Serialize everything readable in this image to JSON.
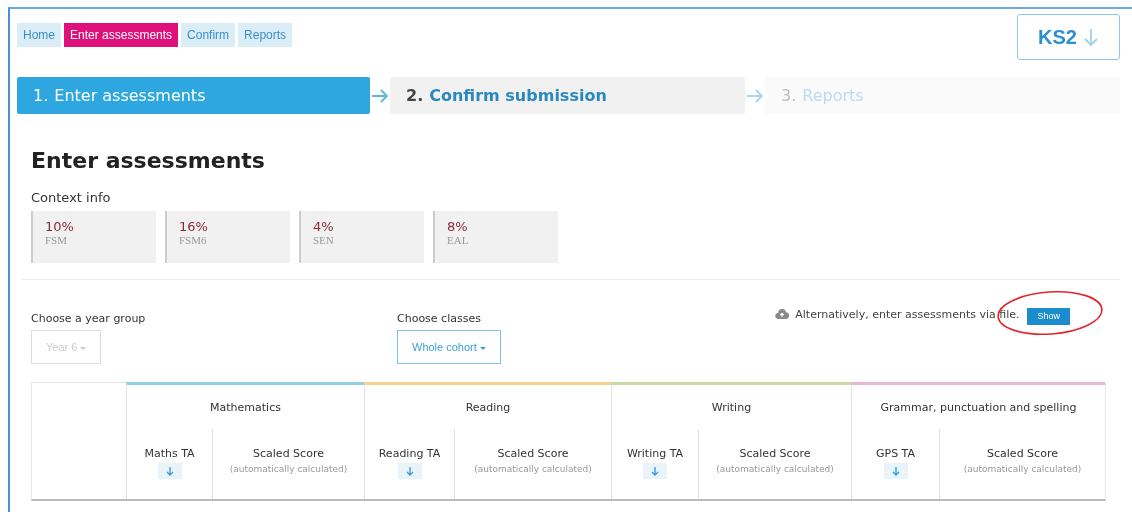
{
  "nav": [
    {
      "label": "Home",
      "selected": false
    },
    {
      "label": "Enter assessments",
      "selected": true
    },
    {
      "label": "Confirm",
      "selected": false
    },
    {
      "label": "Reports",
      "selected": false
    }
  ],
  "stage_selector": {
    "label": "KS2"
  },
  "steps": [
    {
      "number": "1.",
      "label": "Enter assessments",
      "selected": true,
      "disabled": false
    },
    {
      "number": "2.",
      "label": "Confirm submission",
      "selected": false,
      "disabled": false
    },
    {
      "number": "3.",
      "label": "Reports",
      "selected": false,
      "disabled": true
    }
  ],
  "heading": "Enter assessments",
  "context_info": {
    "title": "Context info",
    "stats": [
      {
        "value": "10%",
        "label": "FSM"
      },
      {
        "value": "16%",
        "label": "FSM6"
      },
      {
        "value": "4%",
        "label": "SEN"
      },
      {
        "value": "8%",
        "label": "EAL"
      }
    ]
  },
  "year_group": {
    "label": "Choose a year group",
    "value": "Year 6",
    "disabled": true
  },
  "classes": {
    "label": "Choose classes",
    "value": "Whole cohort",
    "disabled": false
  },
  "file_upload": {
    "text": "Alternatively, enter assessments via file.",
    "button": "Show",
    "highlighted": true
  },
  "table": {
    "subjects": [
      {
        "name": "Mathematics",
        "color": "#8fd0e6",
        "ta": "Maths TA",
        "score": "Scaled Score",
        "score_note": "(automatically calculated)"
      },
      {
        "name": "Reading",
        "color": "#f7d08a",
        "ta": "Reading TA",
        "score": "Scaled Score",
        "score_note": "(automatically calculated)"
      },
      {
        "name": "Writing",
        "color": "#c9d8a6",
        "ta": "Writing TA",
        "score": "Scaled Score",
        "score_note": "(automatically calculated)"
      },
      {
        "name": "Grammar, punctuation and spelling",
        "color": "#e6b8d8",
        "ta": "GPS TA",
        "score": "Scaled Score",
        "score_note": "(automatically calculated)"
      }
    ]
  }
}
